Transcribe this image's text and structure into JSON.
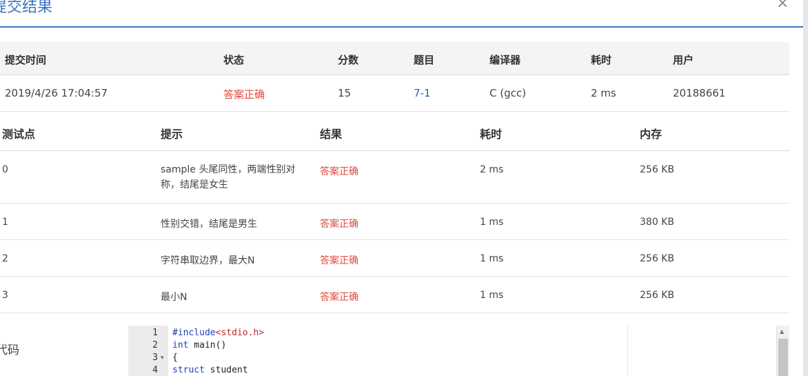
{
  "modal": {
    "title": "提交结果",
    "close": "×"
  },
  "summary": {
    "headers": [
      "提交时间",
      "状态",
      "分数",
      "题目",
      "编译器",
      "耗时",
      "用户"
    ],
    "row": {
      "time": "2019/4/26 17:04:57",
      "status": "答案正确",
      "score": "15",
      "problem": "7-1",
      "compiler": "C (gcc)",
      "duration": "2 ms",
      "user": "20188661"
    }
  },
  "cases": {
    "headers": [
      "测试点",
      "提示",
      "结果",
      "耗时",
      "内存"
    ],
    "rows": [
      {
        "id": "0",
        "hint": "sample 头尾同性，两端性别对称，结尾是女生",
        "result": "答案正确",
        "time": "2 ms",
        "memory": "256 KB"
      },
      {
        "id": "1",
        "hint": "性别交错，结尾是男生",
        "result": "答案正确",
        "time": "1 ms",
        "memory": "380 KB"
      },
      {
        "id": "2",
        "hint": "字符串取边界，最大N",
        "result": "答案正确",
        "time": "1 ms",
        "memory": "256 KB"
      },
      {
        "id": "3",
        "hint": "最小N",
        "result": "答案正确",
        "time": "1 ms",
        "memory": "256 KB"
      }
    ]
  },
  "code": {
    "label": "代码",
    "lines": [
      {
        "num": "1",
        "include": "#include",
        "header": "<stdio.h>"
      },
      {
        "num": "2",
        "kw": "int",
        "rest": " main()"
      },
      {
        "num": "3",
        "text": "{",
        "fold": "▾"
      },
      {
        "num": "4",
        "kw": "struct",
        "rest": " student"
      }
    ]
  },
  "colors": {
    "accent": "#3a74c3",
    "success": "#e04a3f",
    "link": "#2a64b1"
  }
}
